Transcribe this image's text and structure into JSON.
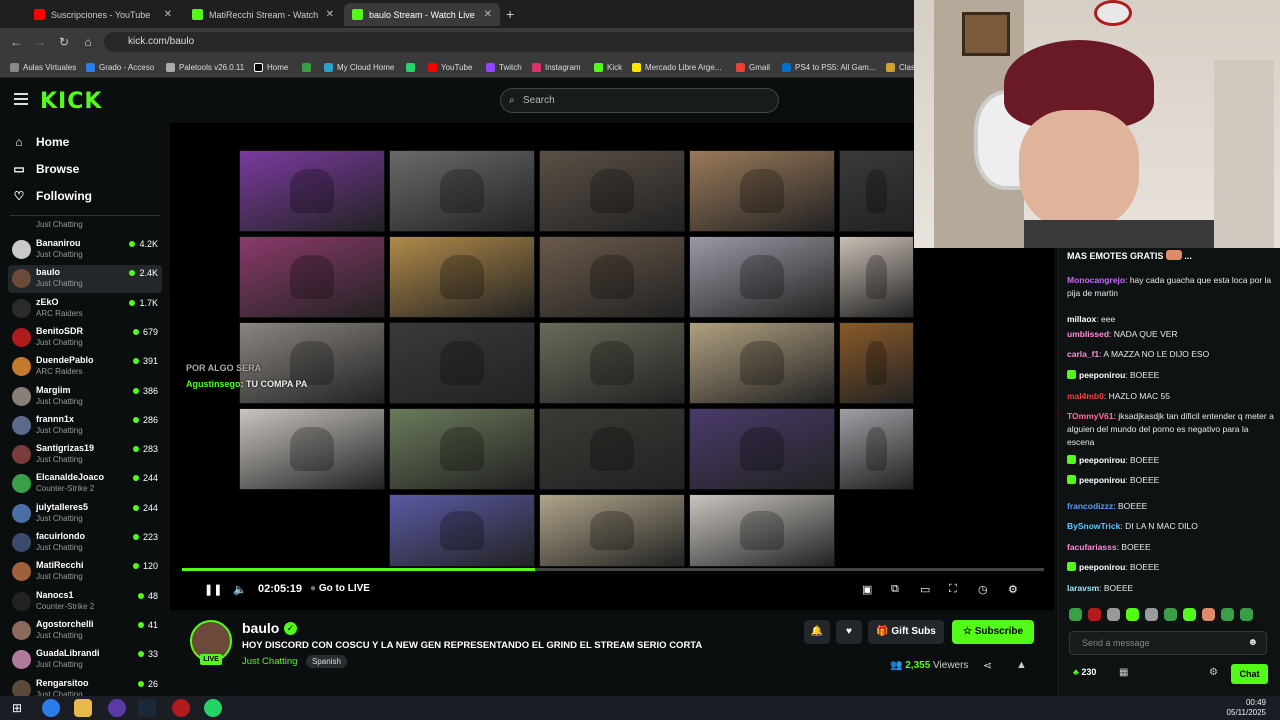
{
  "browser": {
    "tabs": [
      {
        "title": "Suscripciones - YouTube",
        "color": "#ff0000"
      },
      {
        "title": "MatiRecchi Stream - Watch Live",
        "color": "#53fc18"
      },
      {
        "title": "baulo Stream - Watch Live",
        "color": "#53fc18"
      }
    ],
    "url": "kick.com/baulo",
    "bookmarks": [
      "Aulas Virtuales",
      "Grado - Acceso",
      "Paletools v26.0.11",
      "Home",
      "My Cloud Home",
      "YouTube",
      "Twitch",
      "Instagram",
      "Kick",
      "Mercado Libre Arge...",
      "Gmail",
      "PS4 to PS5: All Gam...",
      "Clase"
    ]
  },
  "header": {
    "logo": "KICK",
    "search_placeholder": "Search"
  },
  "sidebar": {
    "nav": [
      {
        "label": "Home",
        "icon": "home-icon"
      },
      {
        "label": "Browse",
        "icon": "browse-icon"
      },
      {
        "label": "Following",
        "icon": "heart-icon"
      }
    ],
    "top_category": "Just Chatting",
    "channels": [
      {
        "name": "Bananirou",
        "category": "Just Chatting",
        "viewers": "4.2K",
        "color": "#c9c9c9"
      },
      {
        "name": "baulo",
        "category": "Just Chatting",
        "viewers": "2.4K",
        "color": "#6b4a3a",
        "selected": true
      },
      {
        "name": "zEkO",
        "category": "ARC Raiders",
        "viewers": "1.7K",
        "color": "#2b2b2b"
      },
      {
        "name": "BenitoSDR",
        "category": "Just Chatting",
        "viewers": "679",
        "color": "#b01b1b"
      },
      {
        "name": "DuendePablo",
        "category": "ARC Raiders",
        "viewers": "391",
        "color": "#c47a2a"
      },
      {
        "name": "Margiim",
        "category": "Just Chatting",
        "viewers": "386",
        "color": "#8a7f78"
      },
      {
        "name": "frannn1x",
        "category": "Just Chatting",
        "viewers": "286",
        "color": "#5b6a8a"
      },
      {
        "name": "Santigrizas19",
        "category": "Just Chatting",
        "viewers": "283",
        "color": "#7a3b3b"
      },
      {
        "name": "ElcanaldeJoaco",
        "category": "Counter-Strike 2",
        "viewers": "244",
        "color": "#3aa047"
      },
      {
        "name": "julytalleres5",
        "category": "Just Chatting",
        "viewers": "244",
        "color": "#4a6fa5"
      },
      {
        "name": "facuirlondo",
        "category": "Just Chatting",
        "viewers": "223",
        "color": "#3a4a6a"
      },
      {
        "name": "MatiRecchi",
        "category": "Just Chatting",
        "viewers": "120",
        "color": "#a0603a"
      },
      {
        "name": "Nanocs1",
        "category": "Counter-Strike 2",
        "viewers": "48",
        "color": "#222"
      },
      {
        "name": "Agostorchelli",
        "category": "Just Chatting",
        "viewers": "41",
        "color": "#8a6a5a"
      },
      {
        "name": "GuadaLibrandi",
        "category": "Just Chatting",
        "viewers": "33",
        "color": "#b07a9a"
      },
      {
        "name": "Rengarsitoo",
        "category": "Just Chatting",
        "viewers": "26",
        "color": "#5a4a3a"
      }
    ]
  },
  "player": {
    "overlay_user": "Agustinsego",
    "overlay_text": "TU COMPA PA",
    "overlay_prev": "POR ALGO SERA",
    "time": "02:05:19",
    "go_live": "Go to LIVE",
    "progress": 0.41,
    "cells": [
      "#7a3aa0",
      "#6a6a6a",
      "#5a5045",
      "#9a7a5a",
      "#3a3a3a",
      "#8a3a6a",
      "#b08a4a",
      "#6a5a4a",
      "#9a9aa5",
      "#c9bfb5",
      "#8a8580",
      "#3a3a3a",
      "#6a6a5a",
      "#b0a080",
      "#8a5a2a",
      "#c9c5c0",
      "#6a7a5a",
      "#3a3a35",
      "#4a3a6a",
      "#a0a0a5",
      "#5a5aa5",
      "#b0a58a",
      "#c9c5c0"
    ]
  },
  "stream": {
    "name": "baulo",
    "title": "HOY DISCORD CON COSCU Y LA NEW GEN REPRESENTANDO EL GRIND EL STREAM SERIO CORTA",
    "category": "Just Chatting",
    "language": "Spanish",
    "live": "LIVE",
    "gift_subs": "Gift Subs",
    "subscribe": "Subscribe",
    "viewers_count": "2,355",
    "viewers_label": "Viewers"
  },
  "chat": {
    "pinned": "MAS EMOTES GRATIS",
    "messages": [
      {
        "user": "Monocangrejo",
        "color": "#c86bff",
        "text": "hay cada guacha que esta loca por la pija de martin"
      },
      {
        "user": "millaox",
        "color": "#ffffff",
        "text": "eee"
      },
      {
        "user": "umblissed",
        "color": "#ff8ad8",
        "text": "NADA QUE VER"
      },
      {
        "user": "carla_f1",
        "color": "#ff8ad8",
        "text": "A MAZZA NO LE DIJO ESO"
      },
      {
        "user": "peeponirou",
        "color": "#ffffff",
        "text": "BOEEE"
      },
      {
        "user": "mal4mb0",
        "color": "#ff3b3b",
        "text": "HAZLO MAC 55"
      },
      {
        "user": "TOmmyV61",
        "color": "#ff6b9a",
        "text": "jksadjkasdjk tan dificil entender q meter a alguien del mundo del porno es negativo para la escena"
      },
      {
        "user": "peeponirou",
        "color": "#ffffff",
        "text": "BOEEE"
      },
      {
        "user": "peeponirou",
        "color": "#ffffff",
        "text": "BOEEE"
      },
      {
        "user": "francodizzz",
        "color": "#5b9bff",
        "text": "BOEEE"
      },
      {
        "user": "BySnowTrick",
        "color": "#5bc9ff",
        "text": "DI LA N MAC DILO"
      },
      {
        "user": "facufariasss",
        "color": "#ff8ad8",
        "text": "BOEEE"
      },
      {
        "user": "peeponirou",
        "color": "#ffffff",
        "text": "BOEEE"
      },
      {
        "user": "laravsm",
        "color": "#a0e8ff",
        "text": "BOEEE"
      }
    ],
    "input_placeholder": "Send a message",
    "points": "230",
    "chat_button": "Chat"
  },
  "taskbar": {
    "time": "00:49",
    "date": "05/11/2025"
  }
}
